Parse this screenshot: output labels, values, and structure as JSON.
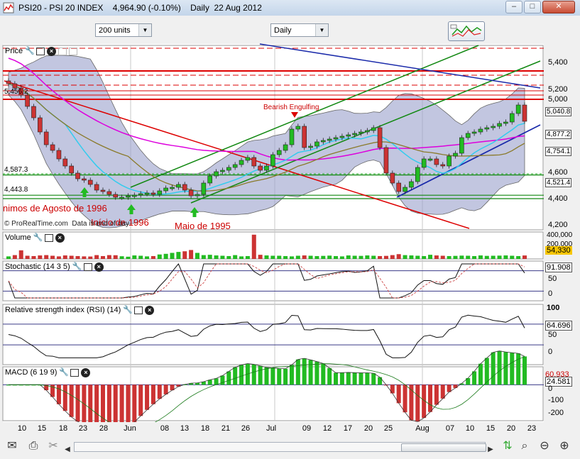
{
  "window": {
    "title_symbol": "PSI20 - PSI 20 INDEX",
    "title_price": "4,964.90 (-0.10%)",
    "title_period": "Daily  22 Aug 2012",
    "minimize": "–",
    "maximize": "□",
    "close": "✕"
  },
  "toolbar": {
    "units_select": "200 units",
    "period_select": "Daily"
  },
  "panels": {
    "price": {
      "name": "Price"
    },
    "volume": {
      "name": "Volume"
    },
    "stochastic": {
      "name": "Stochastic (14 3 5)"
    },
    "rsi": {
      "name": "Relative strength index (RSI) (14)"
    },
    "macd": {
      "name": "MACD (6 19 9)"
    }
  },
  "annotations": {
    "bearish": "Bearish Engulfing",
    "minimos": "nimos de Agosto de 1996",
    "inicio": "Início de 1996",
    "maio": "Maio de 1995",
    "level_5456": "5,456.2",
    "level_4587": "4,587.3",
    "level_4443": "4,443.8",
    "credit": "© ProRealTime.com  Data is end of day"
  },
  "right_axis": {
    "price_ticks": [
      "5,400",
      "5,200",
      "5,000",
      "4,600",
      "4,400",
      "4,200"
    ],
    "price_tags": [
      "5,040.8",
      "4,877.2",
      "4,754.1",
      "4,521.4"
    ],
    "volume_ticks": [
      "400,000",
      "200,000"
    ],
    "volume_tag": "54,330",
    "stoch_ticks": [
      "100",
      "50",
      "0"
    ],
    "stoch_tag": "91.908",
    "rsi_ticks": [
      "100",
      "50",
      "0"
    ],
    "rsi_tag": "64.696",
    "macd_ticks": [
      "0",
      "-100",
      "-200"
    ],
    "macd_tags": [
      "60.933",
      "24.581"
    ]
  },
  "x_axis": {
    "labels": [
      "10",
      "15",
      "18",
      "23",
      "28",
      "Jun",
      "08",
      "13",
      "18",
      "21",
      "26",
      "Jul",
      "09",
      "12",
      "17",
      "20",
      "25",
      "Aug",
      "07",
      "10",
      "15",
      "20",
      "23"
    ]
  },
  "colors": {
    "up": "#22bb22",
    "down": "#cc3333",
    "band_fill": "#9aa0cc",
    "ma_magenta": "#dd00dd",
    "ma_cyan": "#33ccee",
    "ma_olive": "#8a7a2a",
    "trend_red": "#dd0000",
    "trend_green": "#118811",
    "trend_blue": "#1a2aaa"
  },
  "chart_data": {
    "type": "candlestick",
    "instrument": "PSI20",
    "price_scale": [
      4200,
      5500
    ],
    "close": [
      5230,
      5200,
      5150,
      5070,
      4990,
      4890,
      4800,
      4760,
      4700,
      4650,
      4600,
      4560,
      4550,
      4520,
      4480,
      4470,
      4450,
      4430,
      4430,
      4440,
      4445,
      4455,
      4460,
      4450,
      4475,
      4495,
      4500,
      4520,
      4480,
      4440,
      4450,
      4530,
      4580,
      4610,
      4620,
      4640,
      4660,
      4690,
      4710,
      4650,
      4620,
      4650,
      4730,
      4760,
      4800,
      4910,
      4930,
      4780,
      4790,
      4820,
      4830,
      4840,
      4850,
      4860,
      4870,
      4880,
      4890,
      4900,
      4920,
      4780,
      4600,
      4530,
      4470,
      4500,
      4540,
      4640,
      4700,
      4700,
      4660,
      4650,
      4720,
      4740,
      4850,
      4880,
      4890,
      4910,
      4920,
      4930,
      4950,
      4960,
      5020,
      5080,
      4965
    ],
    "volume": {
      "scale": [
        0,
        400000
      ],
      "values": [
        40000,
        60000,
        135000,
        50000,
        45000,
        55000,
        60000,
        50000,
        40000,
        55000,
        50000,
        45000,
        40000,
        38000,
        60000,
        45000,
        60000,
        58000,
        42000,
        35000,
        55000,
        50000,
        40000,
        45000,
        70000,
        80000,
        95000,
        110000,
        120000,
        140000,
        95000,
        60000,
        65000,
        55000,
        50000,
        45000,
        60000,
        40000,
        45000,
        380000,
        65000,
        55000,
        50000,
        50000,
        45000,
        40000,
        50000,
        55000,
        50000,
        45000,
        48000,
        52000,
        45000,
        40000,
        55000,
        50000,
        48000,
        55000,
        50000,
        45000,
        48000,
        60000,
        75000,
        60000,
        55000,
        50000,
        45000,
        65000,
        55000,
        50000,
        45000,
        48000,
        52000,
        50000,
        45000,
        55000,
        48000,
        50000,
        52000,
        55000,
        50000,
        45000,
        54330
      ]
    },
    "stochastic": {
      "scale": [
        0,
        100
      ],
      "last": 91.908
    },
    "rsi": {
      "scale": [
        0,
        100
      ],
      "last": 64.696
    },
    "macd": {
      "scale": [
        -220,
        110
      ],
      "last_macd": 60.933,
      "last_signal": 24.581
    },
    "x": [
      "10",
      "15",
      "18",
      "23",
      "28",
      "Jun",
      "08",
      "13",
      "18",
      "21",
      "26",
      "Jul",
      "09",
      "12",
      "17",
      "20",
      "25",
      "Aug",
      "07",
      "10",
      "15",
      "20",
      "23"
    ],
    "title": "PSI20 - PSI 20 INDEX"
  }
}
